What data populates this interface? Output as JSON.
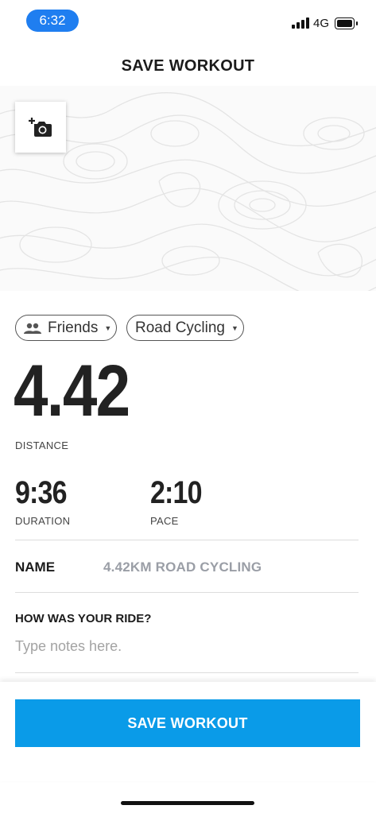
{
  "status_bar": {
    "time": "6:32",
    "network": "4G"
  },
  "header": {
    "title": "SAVE WORKOUT"
  },
  "photo": {
    "add_photo_icon": "camera-plus-icon"
  },
  "chips": {
    "visibility": {
      "label": "Friends",
      "icon": "people-icon"
    },
    "activity_type": {
      "label": "Road Cycling"
    }
  },
  "stats": {
    "distance": {
      "value": "4.42",
      "label": "DISTANCE"
    },
    "duration": {
      "value": "9:36",
      "label": "DURATION"
    },
    "pace": {
      "value": "2:10",
      "label": "PACE"
    }
  },
  "name_row": {
    "label": "NAME",
    "value": "4.42KM ROAD CYCLING"
  },
  "notes": {
    "question": "HOW WAS YOUR RIDE?",
    "placeholder": "Type notes here."
  },
  "footer": {
    "save_label": "SAVE WORKOUT",
    "accent": "#0a9be8"
  }
}
